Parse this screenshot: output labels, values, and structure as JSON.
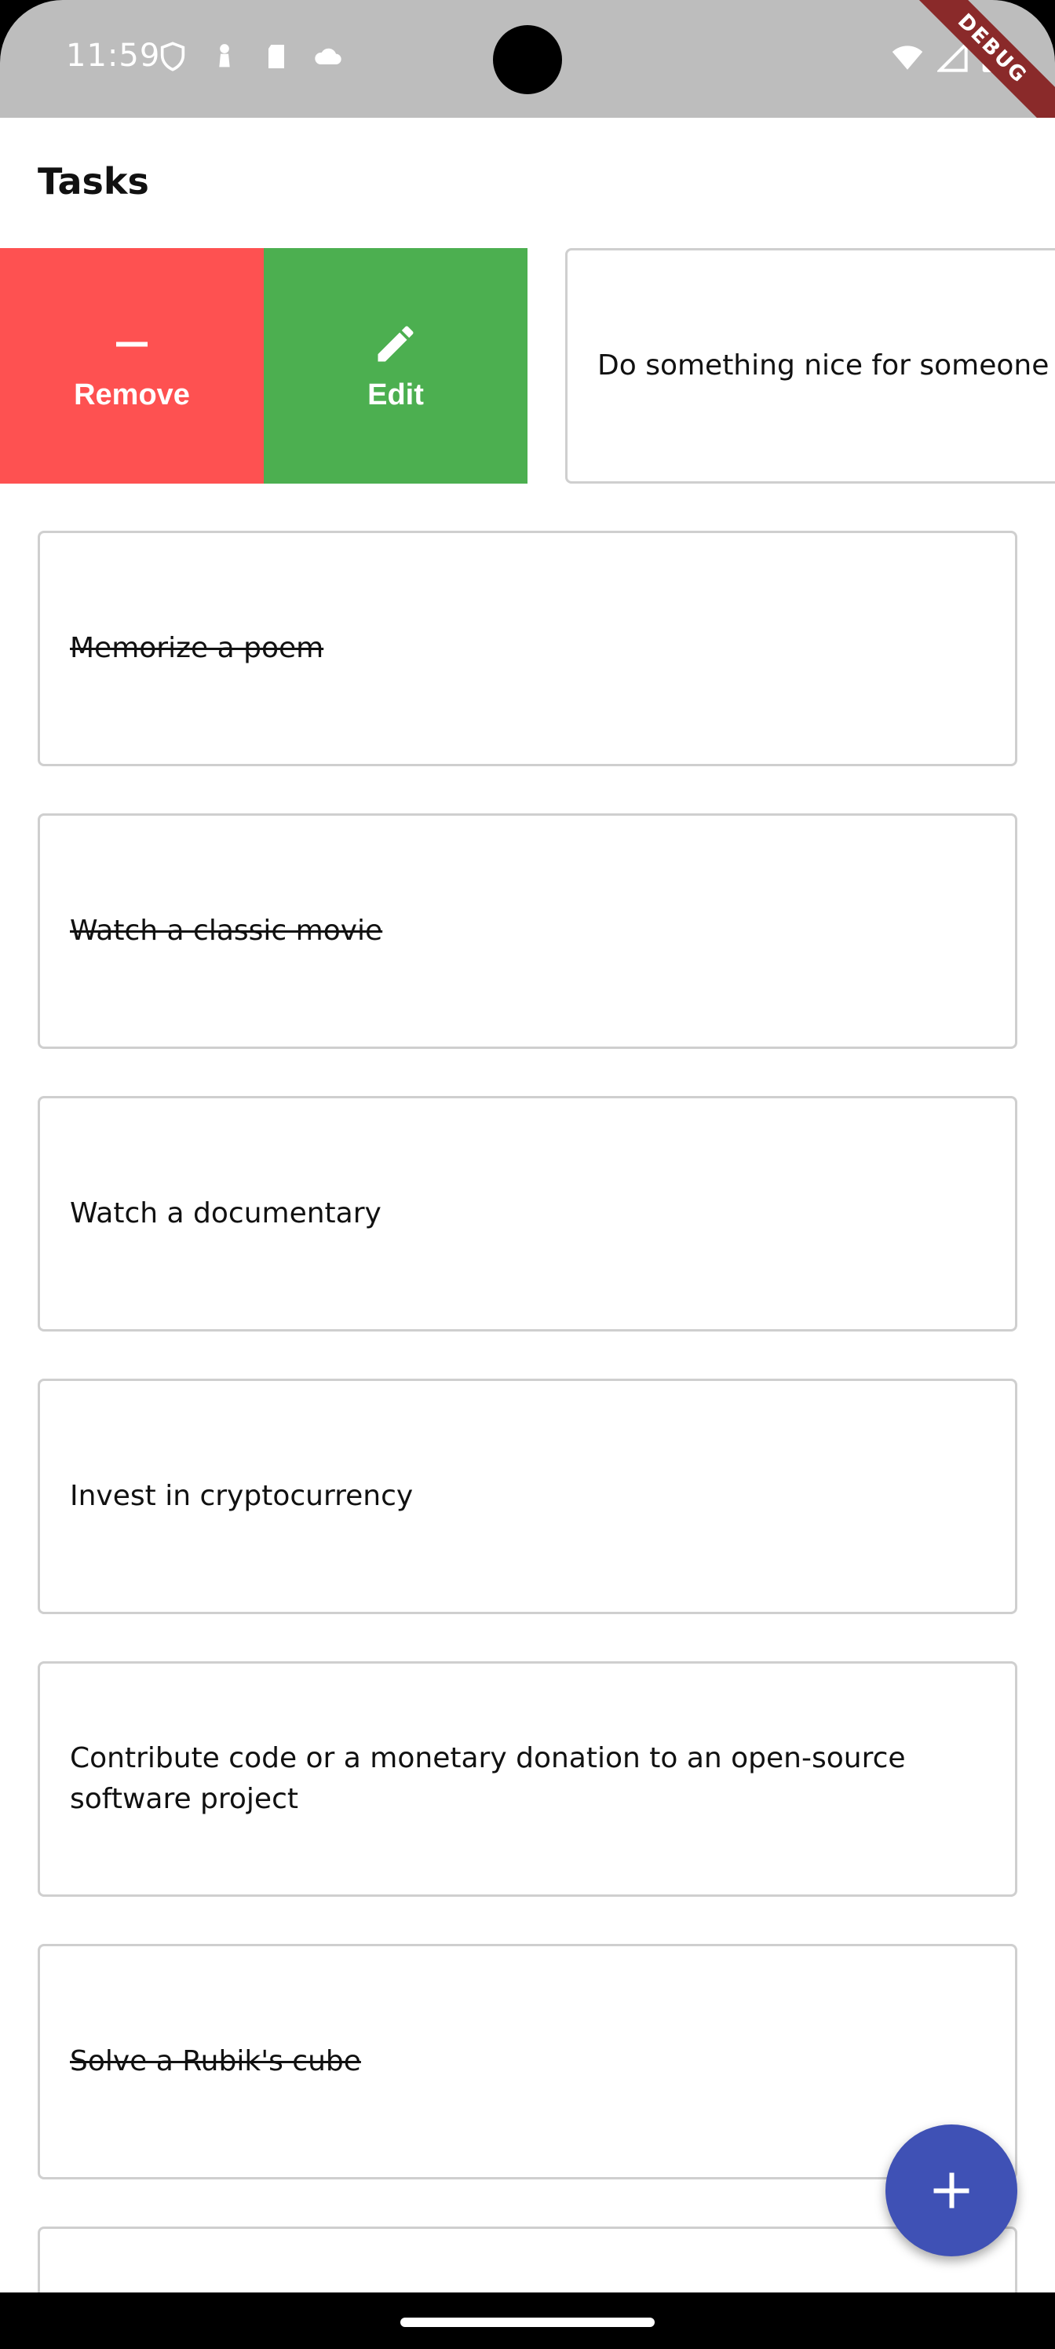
{
  "status_bar": {
    "time": "11:59",
    "debug_label": "DEBUG"
  },
  "app": {
    "title": "Tasks"
  },
  "swipe_actions": {
    "remove_label": "Remove",
    "edit_label": "Edit",
    "remove_color": "#fe5151",
    "edit_color": "#4caf50"
  },
  "tasks": [
    {
      "text": "Do something nice for someone",
      "completed": false
    },
    {
      "text": "Memorize a poem",
      "completed": true
    },
    {
      "text": "Watch a classic movie",
      "completed": true
    },
    {
      "text": "Watch a documentary",
      "completed": false
    },
    {
      "text": "Invest in cryptocurrency",
      "completed": false
    },
    {
      "text": "Contribute code or a monetary donation to an open-source software project",
      "completed": false
    },
    {
      "text": "Solve a Rubik's cube",
      "completed": true
    }
  ],
  "fab": {
    "icon": "plus-icon",
    "color": "#3f51b5"
  }
}
